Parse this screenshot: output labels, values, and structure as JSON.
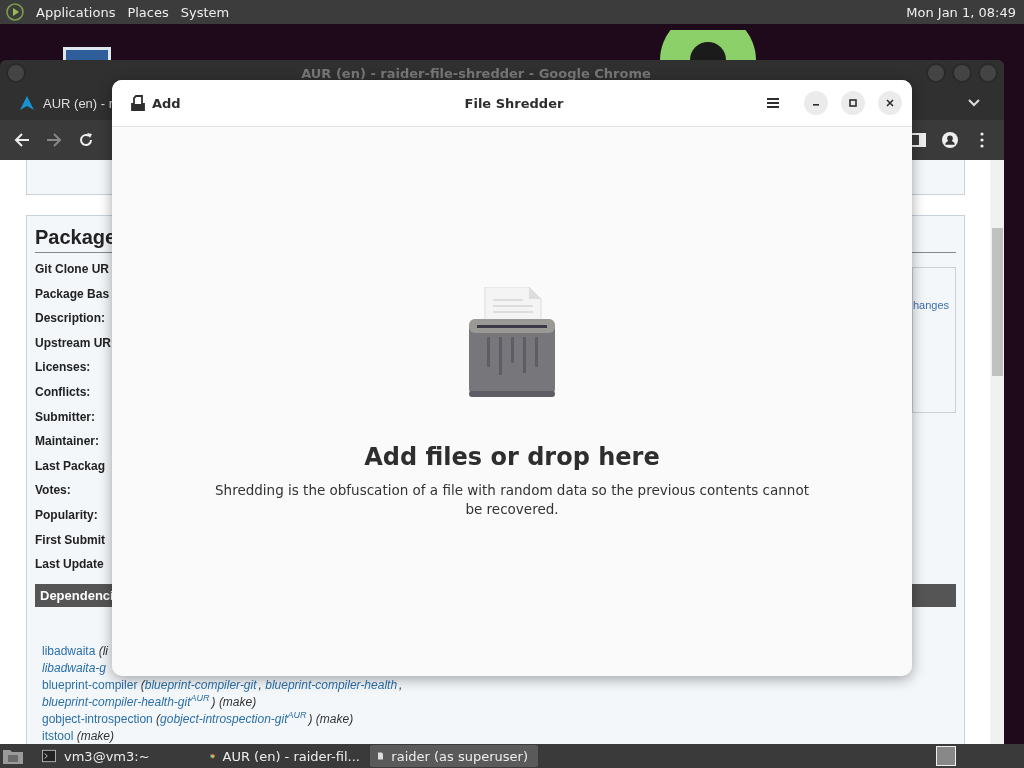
{
  "top_panel": {
    "menus": [
      "Applications",
      "Places",
      "System"
    ],
    "clock": "Mon Jan 1, 08:49"
  },
  "browser": {
    "title": "AUR (en) - raider-file-shredder - Google Chrome",
    "tab": "AUR (en) - r",
    "page": {
      "heading": "Package",
      "fields": [
        "Git Clone UR",
        "Package Bas",
        "Description:",
        "Upstream UR",
        "Licenses:",
        "Conflicts:",
        "Submitter:",
        "Maintainer:",
        "Last Packag",
        "Votes:",
        "Popularity:",
        "First Submit",
        "Last Update"
      ],
      "side_link": "hanges",
      "section": "Dependenci",
      "dependencies": [
        [
          {
            "kind": "link",
            "text": "libadwaita"
          },
          {
            "kind": "note",
            "text": " (li"
          }
        ],
        [
          {
            "kind": "alt",
            "text": "libadwaita-g"
          }
        ],
        [
          {
            "kind": "link",
            "text": "blueprint-compiler"
          },
          {
            "kind": "note",
            "text": " ("
          },
          {
            "kind": "alt",
            "text": "blueprint-compiler-git"
          },
          {
            "kind": "note",
            "text": ", "
          },
          {
            "kind": "alt",
            "text": "blueprint-compiler-health"
          },
          {
            "kind": "note",
            "text": ","
          }
        ],
        [
          {
            "kind": "alt",
            "text": "blueprint-compiler-health-git$^{AUR}$"
          },
          {
            "kind": "note",
            "text": ") (make)"
          }
        ],
        [
          {
            "kind": "link",
            "text": "gobject-introspection"
          },
          {
            "kind": "note",
            "text": " ("
          },
          {
            "kind": "alt",
            "text": "gobject-introspection-git$^{AUR}$"
          },
          {
            "kind": "note",
            "text": ") (make)"
          }
        ],
        [
          {
            "kind": "link",
            "text": "itstool"
          },
          {
            "kind": "note",
            "text": " (make)"
          }
        ]
      ]
    }
  },
  "dialog": {
    "add_button": "Add",
    "title": "File Shredder",
    "heading": "Add files or drop here",
    "description": "Shredding is the obfuscation of a file with random data so the previous contents cannot be recovered."
  },
  "taskbar": {
    "items": [
      {
        "kind": "terminal",
        "label": "vm3@vm3:~",
        "selected": false
      },
      {
        "kind": "browser",
        "label": "AUR (en) - raider-fil...",
        "selected": false
      },
      {
        "kind": "document",
        "label": "raider (as superuser)",
        "selected": true
      }
    ]
  }
}
